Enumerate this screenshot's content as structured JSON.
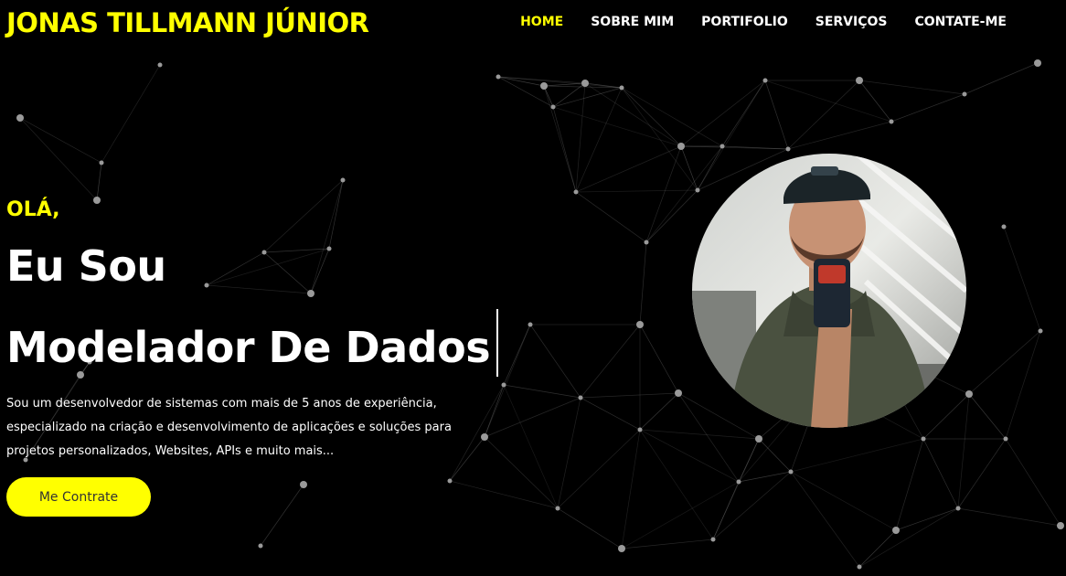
{
  "header": {
    "brand": "JONAS TILLMANN JÚNIOR",
    "nav": [
      {
        "label": "HOME",
        "active": true
      },
      {
        "label": "SOBRE MIM",
        "active": false
      },
      {
        "label": "PORTIFOLIO",
        "active": false
      },
      {
        "label": "SERVIÇOS",
        "active": false
      },
      {
        "label": "CONTATE-ME",
        "active": false
      }
    ]
  },
  "hero": {
    "greeting": "OLÁ,",
    "line1": "Eu Sou",
    "line2": "Modelador De Dados",
    "description": "Sou um desenvolvedor de sistemas com mais de 5 anos de experiência, especializado na criação e desenvolvimento de aplicações e soluções para projetos personalizados, Websites, APIs e muito mais...",
    "cta_label": "Me Contrate",
    "photo_icon": "profile-photo"
  },
  "colors": {
    "background": "#000000",
    "accent": "#ffff00",
    "text": "#ffffff",
    "network": "#888888"
  }
}
